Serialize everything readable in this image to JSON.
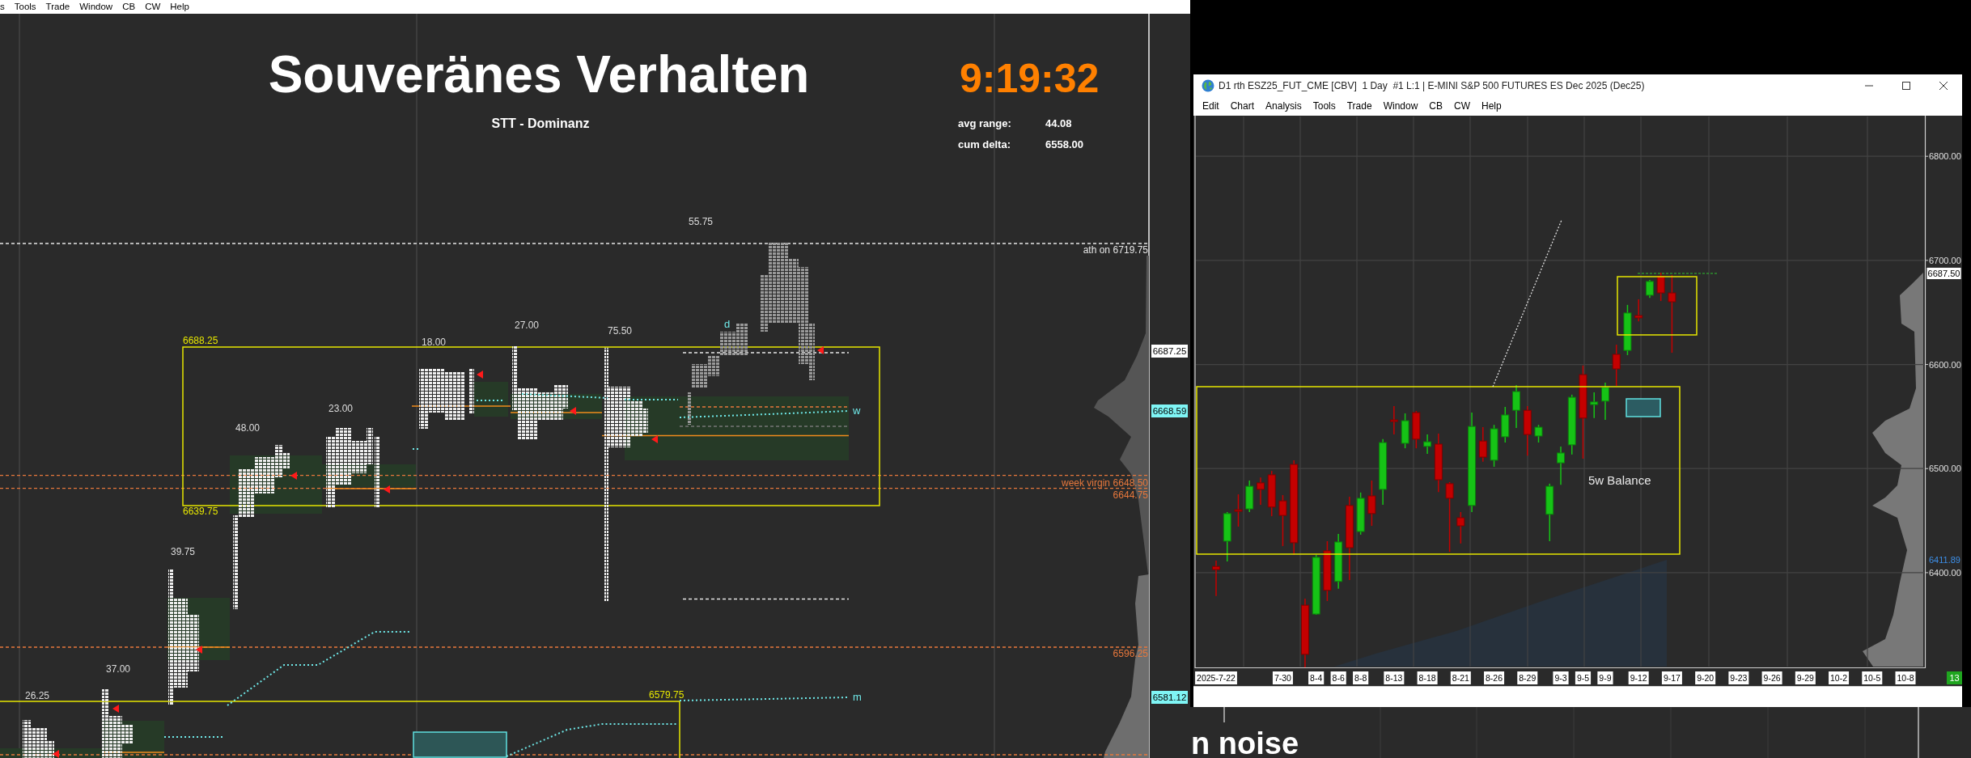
{
  "left_window": {
    "menu": [
      "s",
      "Tools",
      "Trade",
      "Window",
      "CB",
      "CW",
      "Help"
    ],
    "chart": {
      "title": "Souveränes Verhalten",
      "subtitle": "STT - Dominanz",
      "clock": "9:19:32",
      "stats": [
        {
          "label": "avg range:",
          "value": "44.08"
        },
        {
          "label": "cum delta:",
          "value": "6558.00"
        }
      ],
      "range_labels": [
        "55.75",
        "27.00",
        "75.50",
        "18.00",
        "23.00",
        "48.00",
        "39.75",
        "37.00",
        "26.25"
      ],
      "box_labels": [
        "6688.25",
        "6639.75",
        "6579.75"
      ],
      "vwap_labels": [
        "d",
        "w",
        "m"
      ],
      "level_lines": [
        {
          "kind": "ath",
          "label": "ath on",
          "price": "6719.75"
        },
        {
          "kind": "virgin",
          "label": "week virgin",
          "price": "6648.50"
        },
        {
          "kind": "virgin",
          "price": "6644.75"
        },
        {
          "kind": "virgin",
          "price": "6596.25"
        }
      ],
      "price_axis": [
        {
          "kind": "last",
          "text": "6687.25"
        },
        {
          "kind": "vwap",
          "text": "6668.59"
        },
        {
          "kind": "vwap",
          "text": "6581.12"
        }
      ]
    }
  },
  "chart_window": {
    "title": "D1 rth ESZ25_FUT_CME [CBV]  1 Day  #1 L:1 | E-MINI S&P 500 FUTURES ES Dec 2025 (Dec25)",
    "menu": [
      "Edit",
      "Chart",
      "Analysis",
      "Tools",
      "Trade",
      "Window",
      "CB",
      "CW",
      "Help"
    ],
    "chart": {
      "annotation": "5w Balance",
      "axis_markers": [
        {
          "kind": "last",
          "text": "6687.50"
        },
        {
          "kind": "poc",
          "text": "6411.89"
        }
      ],
      "corner_badge": "13",
      "chart_data": {
        "type": "candlestick",
        "categories": [
          "2025-7-22",
          null,
          null,
          null,
          null,
          null,
          "7-30",
          null,
          null,
          "8-4",
          null,
          "8-6",
          null,
          "8-8",
          null,
          null,
          "8-13",
          null,
          null,
          "8-18",
          null,
          null,
          "8-21",
          null,
          null,
          "8-26",
          null,
          null,
          "8-29",
          null,
          null,
          "9-3",
          null,
          "9-5",
          null,
          "9-9",
          null,
          null,
          "9-12",
          null,
          null,
          "9-17",
          null,
          null,
          "9-20",
          null,
          null,
          "9-23",
          null,
          null,
          "9-26",
          null,
          null,
          "9-29",
          null,
          null,
          "10-2",
          null,
          null,
          "10-5",
          null,
          null,
          "10-8"
        ],
        "ohlc": [
          [
            6406,
            6411.5,
            6377.5,
            6403
          ],
          [
            6430.25,
            6458.25,
            6410.75,
            6456.75
          ],
          [
            6460.5,
            6475.25,
            6444.25,
            6459
          ],
          [
            6461.25,
            6488.5,
            6458.25,
            6483
          ],
          [
            6486.25,
            6491.5,
            6465.25,
            6480
          ],
          [
            6494,
            6497.75,
            6454.25,
            6463
          ],
          [
            6469,
            6474.5,
            6425.5,
            6455
          ],
          [
            6504,
            6508,
            6417,
            6428.75
          ],
          [
            6368.75,
            6375,
            6309,
            6321.5
          ],
          [
            6360.25,
            6417,
            6359.5,
            6414.75
          ],
          [
            6421,
            6430.25,
            6372.75,
            6383
          ],
          [
            6391.5,
            6437.25,
            6384.5,
            6429.5
          ],
          [
            6464.5,
            6473,
            6393,
            6424
          ],
          [
            6439.5,
            6477,
            6436.5,
            6471.5
          ],
          [
            6473.75,
            6488.5,
            6445,
            6456.75
          ],
          [
            6480,
            6528.25,
            6465.25,
            6525
          ],
          [
            6546.75,
            6560,
            6532.75,
            6545.25
          ],
          [
            6524.25,
            6553,
            6519.5,
            6546
          ],
          [
            6553.75,
            6555.25,
            6519.5,
            6528.25
          ],
          [
            6521.25,
            6532.75,
            6514.25,
            6525.75
          ],
          [
            6523.5,
            6533.5,
            6477.5,
            6489.25
          ],
          [
            6485.5,
            6487,
            6420,
            6471.5
          ],
          [
            6452.75,
            6458.25,
            6428,
            6445
          ],
          [
            6464.5,
            6553.75,
            6458.25,
            6540.5
          ],
          [
            6526.5,
            6539.75,
            6506.5,
            6511
          ],
          [
            6508,
            6542,
            6501.75,
            6538.25
          ],
          [
            6530.5,
            6559.25,
            6525,
            6551.5
          ],
          [
            6556,
            6580.25,
            6539,
            6574
          ],
          [
            6556,
            6560,
            6512.5,
            6532.75
          ],
          [
            6531.25,
            6542,
            6525,
            6539.75
          ],
          [
            6456,
            6485.5,
            6430.25,
            6483
          ],
          [
            6505.5,
            6521.25,
            6484.5,
            6515
          ],
          [
            6522.75,
            6571,
            6513.5,
            6568.5
          ],
          [
            6590.25,
            6599,
            6509.5,
            6548.5
          ],
          [
            6561.5,
            6573.25,
            6548.5,
            6564
          ],
          [
            6564.75,
            6582.5,
            6546.75,
            6578
          ],
          [
            6609.75,
            6619,
            6579.5,
            6595.75
          ],
          [
            6613.5,
            6657.25,
            6609,
            6649.5
          ],
          [
            6647,
            6662.5,
            6641.5,
            6644.75
          ],
          [
            6666.5,
            6681.25,
            6664,
            6679.75
          ],
          [
            6685,
            6688.25,
            6661,
            6668.75
          ],
          [
            6668.75,
            6686,
            6611.25,
            6660.25
          ],
          null,
          null,
          null,
          null,
          null,
          null,
          null,
          null,
          null,
          null,
          null,
          null,
          null,
          null,
          null,
          null,
          null,
          null,
          null,
          null,
          null
        ],
        "ylim": [
          6309,
          6839
        ],
        "yticks": [
          {
            "value": 6800,
            "label": "6800.00"
          },
          {
            "value": 6700,
            "label": "6700.00"
          },
          {
            "value": 6600,
            "label": "6600.00"
          },
          {
            "value": 6500,
            "label": "6500.00"
          },
          {
            "value": 6400,
            "label": "6400.00"
          }
        ],
        "grid": true
      }
    }
  },
  "background_text": "n noise"
}
